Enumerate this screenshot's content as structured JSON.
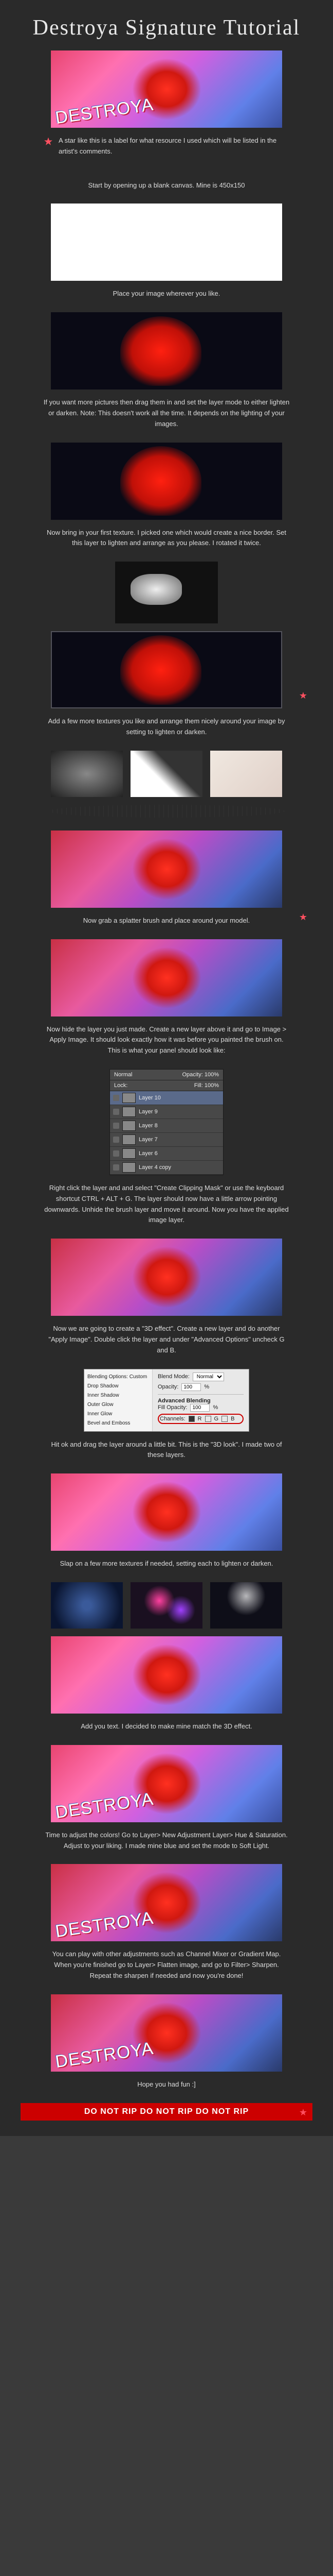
{
  "title": "Destroya Signature Tutorial",
  "intro_star": "A star like this is a label for what resource I used which will be listed in the artist's comments.",
  "steps": {
    "s1": "Start by opening up a blank canvas. Mine is 450x150",
    "s2": "Place your image wherever you like.",
    "s3": "If you want more pictures then drag them in and set the layer mode to either lighten or darken. Note: This doesn't work all the time. It depends on the lighting of your images.",
    "s4": "Now bring in your first texture. I picked one which would create a nice border. Set this layer to lighten and arrange as you please. I rotated it twice.",
    "s5": "Add a few more textures you like and arrange them nicely around your image by setting to lighten or darken.",
    "s6": "Now grab a splatter brush and place around your model.",
    "s7": "Now hide the layer you just made. Create a new layer above it and go to Image > Apply Image. It should look exactly how it was before you painted the brush on. This is what your panel should look like:",
    "s8": "Right click the layer and and select \"Create Clipping Mask\" or use the keyboard shortcut CTRL + ALT + G. The layer should now have a little arrow pointing downwards. Unhide the brush layer and move it around. Now you have the applied image layer.",
    "s9": "Now we are going to create a \"3D effect\". Create a new layer and do another \"Apply Image\". Double click the layer and under \"Advanced Options\" uncheck G and B.",
    "s10": "Hit ok and drag the layer around a little bit. This is the \"3D look\". I made two of these layers.",
    "s11": "Slap on a few more textures if needed, setting each to lighten or darken.",
    "s12": "Add you text. I decided to make mine match the 3D effect.",
    "s13": "Time to adjust the colors! Go to Layer> New Adjustment Layer> Hue & Saturation. Adjust to your liking. I made mine blue and set the mode to Soft Light.",
    "s14": "You can play with other adjustments such as Channel Mixer or Gradient Map. When you're finished go to Layer> Flatten image, and go to Filter> Sharpen. Repeat the sharpen if needed and now you're done!",
    "s15": "Hope you had fun :]"
  },
  "layers_panel": {
    "mode": "Normal",
    "opacity": "Opacity: 100%",
    "lock": "Lock:",
    "fill": "Fill: 100%",
    "layers": [
      "Layer 10",
      "Layer 9",
      "Layer 8",
      "Layer 7",
      "Layer 6",
      "Layer 4 copy"
    ]
  },
  "dialog": {
    "style_items": [
      "Blending Options: Custom",
      "Drop Shadow",
      "Inner Shadow",
      "Outer Glow",
      "Inner Glow",
      "Bevel and Emboss"
    ],
    "blend_label": "Blend Mode:",
    "blend_value": "Normal",
    "opacity_label": "Opacity:",
    "opacity_value": "100",
    "adv_heading": "Advanced Blending",
    "fill_label": "Fill Opacity:",
    "fill_value": "100",
    "channels_label": "Channels:",
    "ch_r": "R",
    "ch_g": "G",
    "ch_b": "B"
  },
  "warning": "DO NOT RIP DO NOT RIP DO NOT RIP"
}
